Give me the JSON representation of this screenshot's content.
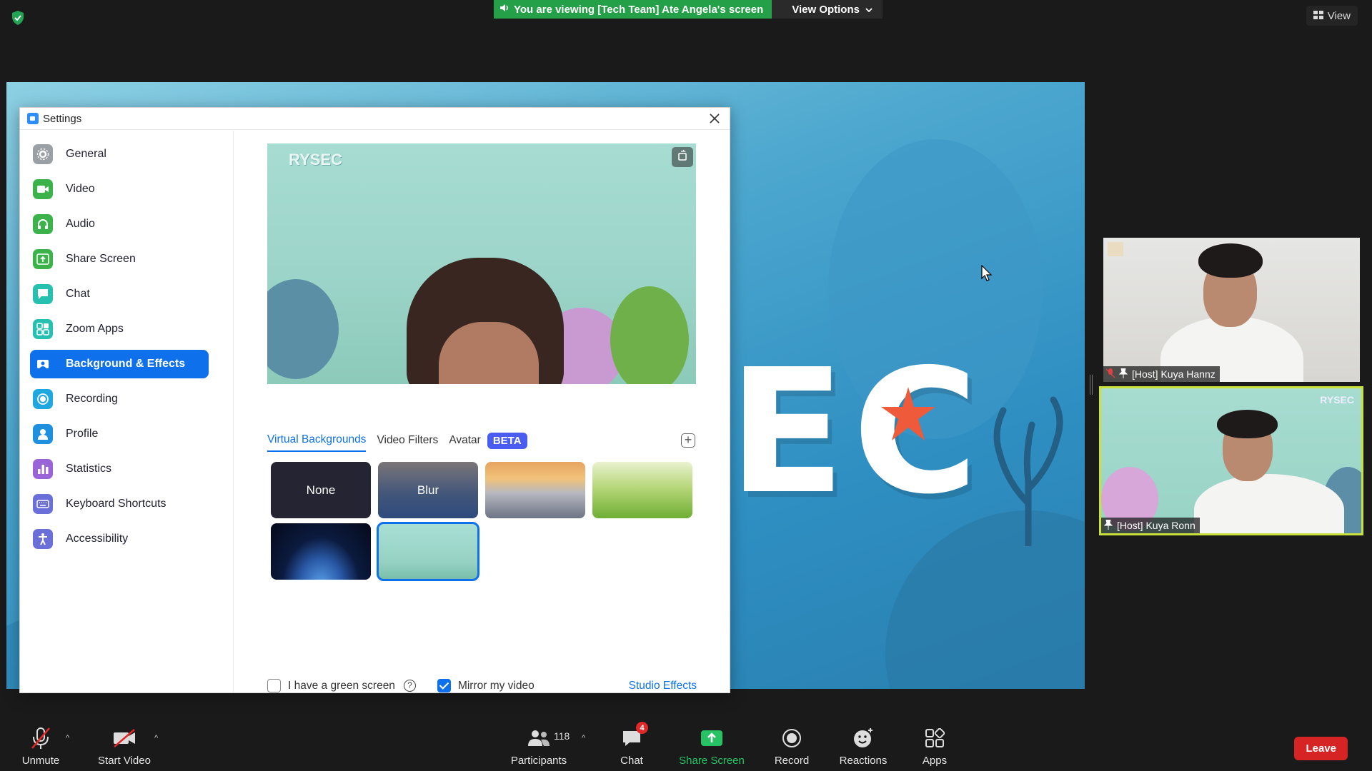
{
  "top": {
    "viewing_text": "You are viewing [Tech Team] Ate Angela's screen",
    "view_options_label": "View Options",
    "view_label": "View"
  },
  "settings": {
    "title": "Settings",
    "nav": [
      {
        "label": "General",
        "icon": "gear-icon",
        "color": "#9aa0a6"
      },
      {
        "label": "Video",
        "icon": "video-icon",
        "color": "#3bb34a"
      },
      {
        "label": "Audio",
        "icon": "headphones-icon",
        "color": "#3bb34a"
      },
      {
        "label": "Share Screen",
        "icon": "share-screen-icon",
        "color": "#3bb34a"
      },
      {
        "label": "Chat",
        "icon": "chat-icon",
        "color": "#26c0b0"
      },
      {
        "label": "Zoom Apps",
        "icon": "apps-icon",
        "color": "#26c0b0"
      },
      {
        "label": "Background & Effects",
        "icon": "background-icon",
        "color": "#0e71eb"
      },
      {
        "label": "Recording",
        "icon": "recording-icon",
        "color": "#1fa7e0"
      },
      {
        "label": "Profile",
        "icon": "profile-icon",
        "color": "#1f8fe0"
      },
      {
        "label": "Statistics",
        "icon": "statistics-icon",
        "color": "#9b63d8"
      },
      {
        "label": "Keyboard Shortcuts",
        "icon": "keyboard-icon",
        "color": "#6b6fd8"
      },
      {
        "label": "Accessibility",
        "icon": "accessibility-icon",
        "color": "#6b6fd8"
      }
    ],
    "active_index": 6,
    "preview_logo": "RYSEC",
    "tabs": [
      "Virtual Backgrounds",
      "Video Filters",
      "Avatar"
    ],
    "beta_label": "BETA",
    "backgrounds": [
      {
        "label": "None",
        "kind": "none"
      },
      {
        "label": "Blur",
        "kind": "blur"
      },
      {
        "label": "",
        "kind": "bridge"
      },
      {
        "label": "",
        "kind": "grass"
      },
      {
        "label": "",
        "kind": "earth"
      },
      {
        "label": "",
        "kind": "ocean",
        "selected": true
      }
    ],
    "green_screen_label": "I have a green screen",
    "green_screen_checked": false,
    "mirror_label": "Mirror my video",
    "mirror_checked": true,
    "studio_effects_label": "Studio Effects"
  },
  "shared_screen": {
    "big_text": "EC"
  },
  "participants": [
    {
      "name": "[Host] Kuya Hannz",
      "muted": true
    },
    {
      "name": "[Host] Kuya Ronn",
      "muted": false,
      "logo": "RYSEC",
      "active_speaker": true
    }
  ],
  "controls": {
    "unmute": "Unmute",
    "start_video": "Start Video",
    "participants": "Participants",
    "participants_count": "118",
    "chat": "Chat",
    "chat_badge": "4",
    "share_screen": "Share Screen",
    "record": "Record",
    "reactions": "Reactions",
    "apps": "Apps",
    "leave": "Leave"
  }
}
